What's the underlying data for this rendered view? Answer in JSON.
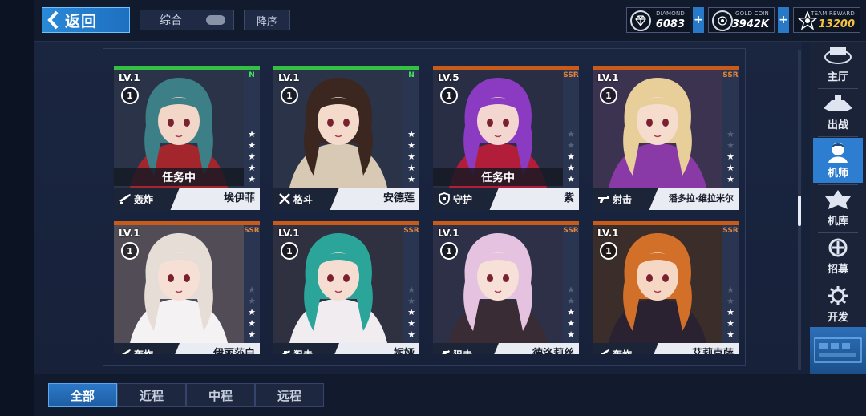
{
  "header": {
    "back_label": "返回",
    "sort_label": "综合",
    "order_label": "降序",
    "resources": [
      {
        "caption": "DIAMOND",
        "value": "6083",
        "icon": "diamond-icon"
      },
      {
        "caption": "GOLD COIN",
        "value": "3942K",
        "icon": "gold-coin-icon"
      },
      {
        "caption": "TEAM REWARD",
        "value": "13200",
        "icon": "team-reward-icon"
      }
    ],
    "plus_label": "+"
  },
  "cards": [
    {
      "level": "LV.1",
      "badge": "1",
      "rarity": "N",
      "stars_on": 5,
      "stars_total": 5,
      "status": "任务中",
      "role": "轰炸",
      "name": "埃伊菲",
      "hair": "#3d7f86",
      "outfit": "#a3262c",
      "skin": "#f2d6c8",
      "bg": "#2b3348"
    },
    {
      "level": "LV.1",
      "badge": "1",
      "rarity": "N",
      "stars_on": 5,
      "stars_total": 5,
      "status": "",
      "role": "格斗",
      "name": "安德莲",
      "hair": "#3b2620",
      "outfit": "#d8c9b4",
      "skin": "#f4dacb",
      "bg": "#2b3348"
    },
    {
      "level": "LV.5",
      "badge": "1",
      "rarity": "SSR",
      "stars_on": 3,
      "stars_total": 5,
      "status": "任务中",
      "role": "守护",
      "name": "紫",
      "hair": "#8a3bc2",
      "outfit": "#b21e3a",
      "skin": "#f2d6cf",
      "bg": "#2a2e44"
    },
    {
      "level": "LV.1",
      "badge": "1",
      "rarity": "SSR",
      "stars_on": 3,
      "stars_total": 5,
      "status": "",
      "role": "射击",
      "name": "潘多拉·维拉米尔",
      "hair": "#e8cf9a",
      "outfit": "#8a3aa6",
      "skin": "#f6dccd",
      "bg": "#3c3350"
    },
    {
      "level": "LV.1",
      "badge": "1",
      "rarity": "SSR",
      "stars_on": 3,
      "stars_total": 5,
      "status": "",
      "role": "轰炸",
      "name": "伊丽莎白",
      "hair": "#e6ddd6",
      "outfit": "#f4f2f2",
      "skin": "#f6e0d6",
      "bg": "#514c55"
    },
    {
      "level": "LV.1",
      "badge": "1",
      "rarity": "SSR",
      "stars_on": 3,
      "stars_total": 5,
      "status": "",
      "role": "狙击",
      "name": "妮娅",
      "hair": "#2ba59a",
      "outfit": "#f0ecef",
      "skin": "#f6ddd2",
      "bg": "#2f3040"
    },
    {
      "level": "LV.1",
      "badge": "1",
      "rarity": "SSR",
      "stars_on": 3,
      "stars_total": 5,
      "status": "",
      "role": "狙击",
      "name": "德洛莉丝",
      "hair": "#e4c2e0",
      "outfit": "#3a2c34",
      "skin": "#f6e0d8",
      "bg": "#2d3046"
    },
    {
      "level": "LV.1",
      "badge": "1",
      "rarity": "SSR",
      "stars_on": 3,
      "stars_total": 5,
      "status": "",
      "role": "轰炸",
      "name": "艾莉克萨",
      "hair": "#d2702a",
      "outfit": "#2a2230",
      "skin": "#f5d7c4",
      "bg": "#3b2d2a"
    }
  ],
  "sidebar": {
    "items": [
      {
        "label": "主厅",
        "icon": "lobby-icon"
      },
      {
        "label": "出战",
        "icon": "sortie-icon"
      },
      {
        "label": "机师",
        "icon": "pilot-icon"
      },
      {
        "label": "机库",
        "icon": "hangar-icon"
      },
      {
        "label": "招募",
        "icon": "recruit-icon"
      },
      {
        "label": "开发",
        "icon": "develop-icon"
      }
    ],
    "active_index": 2
  },
  "filters": {
    "tabs": [
      "全部",
      "近程",
      "中程",
      "远程"
    ],
    "active_index": 0
  },
  "colors": {
    "accent": "#2d7ed0",
    "n_rarity": "#34c043",
    "ssr_rarity": "#c85a1a",
    "gold": "#f4c23f"
  }
}
